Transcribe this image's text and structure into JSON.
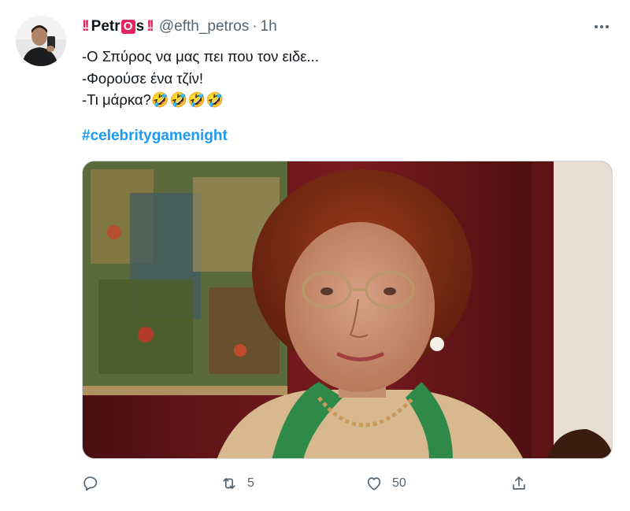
{
  "tweet": {
    "author": {
      "name_prefix": "Petr",
      "name_boxed_letter": "O",
      "name_suffix": "s",
      "handle": "@efth_petros",
      "separator": "·",
      "timestamp": "1h"
    },
    "more_icon": "more-horizontal-icon",
    "text_lines": [
      "-Ο Σπύρος να μας πει που τον ειδε...",
      "-Φορούσε ένα τζίν!",
      "-Τι μάρκα?🤣🤣🤣🤣"
    ],
    "hashtag": "#celebritygamenight",
    "media": {
      "kind": "photo",
      "description_icon": "photo-image"
    },
    "actions": {
      "reply": {
        "icon": "reply-icon",
        "count": ""
      },
      "retweet": {
        "icon": "retweet-icon",
        "count": "5"
      },
      "like": {
        "icon": "heart-icon",
        "count": "50"
      },
      "share": {
        "icon": "share-icon",
        "count": ""
      }
    },
    "colors": {
      "accent": "#1d9bf0",
      "secondary_text": "#536471",
      "badge_red": "#e0245e"
    }
  }
}
